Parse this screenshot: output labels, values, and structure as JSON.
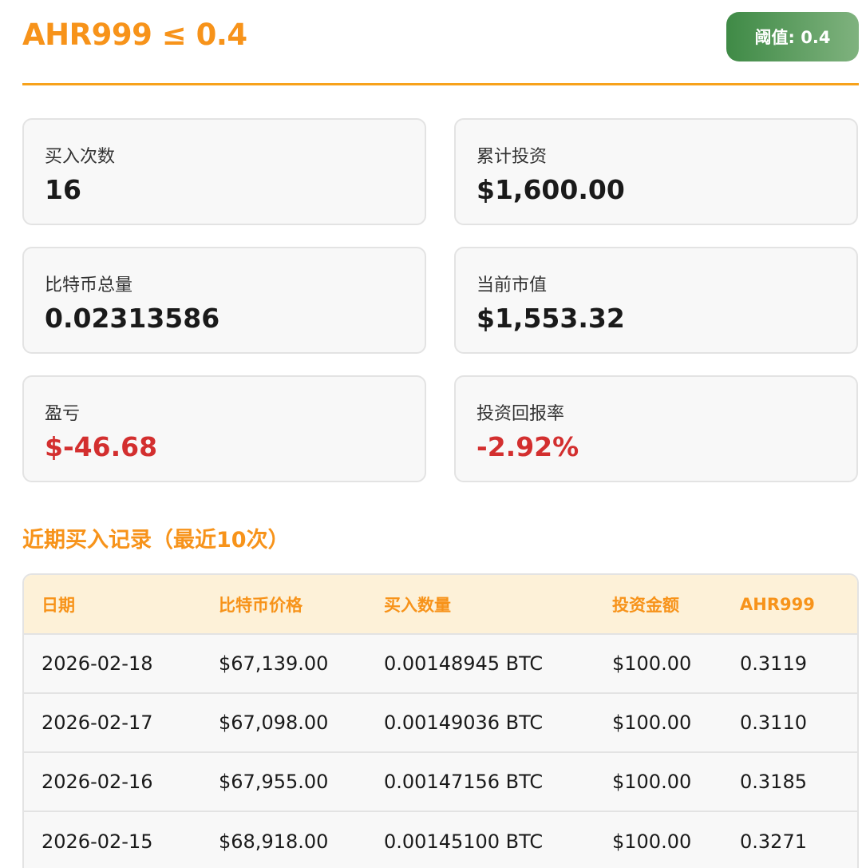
{
  "header": {
    "title": "AHR999 ≤ 0.4",
    "threshold_badge": "阈值: 0.4"
  },
  "stats": [
    {
      "label": "买入次数",
      "value": "16",
      "negative": false
    },
    {
      "label": "累计投资",
      "value": "$1,600.00",
      "negative": false
    },
    {
      "label": "比特币总量",
      "value": "0.02313586",
      "negative": false
    },
    {
      "label": "当前市值",
      "value": "$1,553.32",
      "negative": false
    },
    {
      "label": "盈亏",
      "value": "$-46.68",
      "negative": true
    },
    {
      "label": "投资回报率",
      "value": "-2.92%",
      "negative": true
    }
  ],
  "records": {
    "title": "近期买入记录（最近10次）",
    "columns": [
      "日期",
      "比特币价格",
      "买入数量",
      "投资金额",
      "AHR999"
    ],
    "rows": [
      [
        "2026-02-18",
        "$67,139.00",
        "0.00148945 BTC",
        "$100.00",
        "0.3119"
      ],
      [
        "2026-02-17",
        "$67,098.00",
        "0.00149036 BTC",
        "$100.00",
        "0.3110"
      ],
      [
        "2026-02-16",
        "$67,955.00",
        "0.00147156 BTC",
        "$100.00",
        "0.3185"
      ],
      [
        "2026-02-15",
        "$68,918.00",
        "0.00145100 BTC",
        "$100.00",
        "0.3271"
      ]
    ]
  },
  "colors": {
    "accent": "#f7931a",
    "negative": "#d32f2f",
    "badge": "#4a8f4f"
  }
}
